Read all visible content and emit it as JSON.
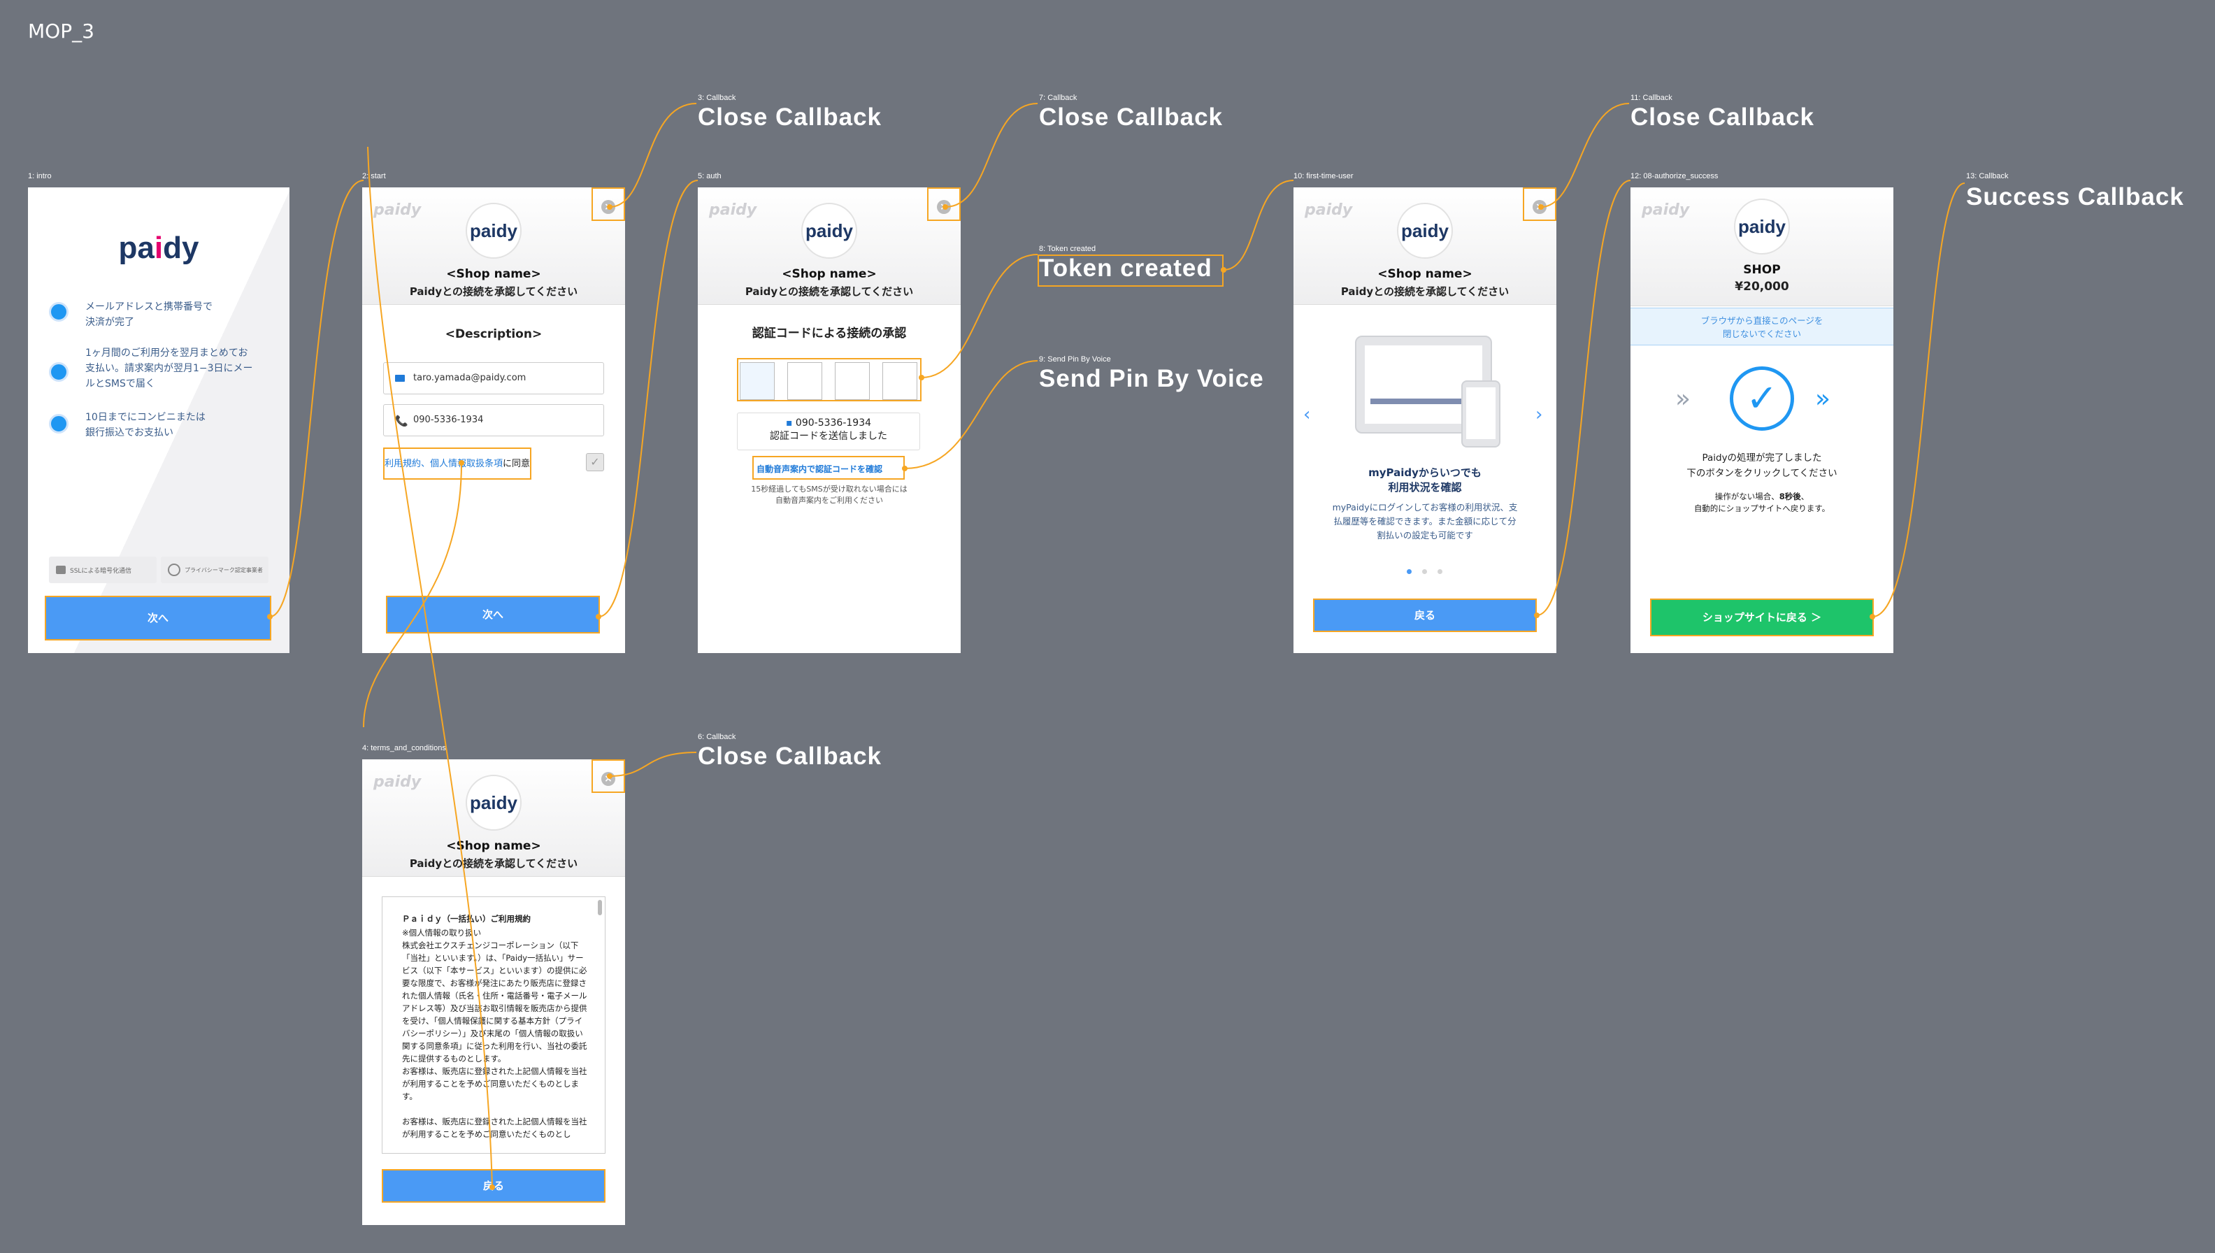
{
  "canvas_title": "MOP_3",
  "frames": {
    "f1": "1: intro",
    "f2": "2: start",
    "f3": "3: Callback",
    "f4": "4: terms_and_conditions",
    "f5": "5: auth",
    "f6": "6: Callback",
    "f7": "7: Callback",
    "f8": "8: Token created",
    "f9": "9: Send Pin By Voice",
    "f10": "10: first-time-user",
    "f11": "11: Callback",
    "f12": "12: 08-authorize_success",
    "f13": "13: Callback"
  },
  "callbacks": {
    "c3": "Close Callback",
    "c6": "Close Callback",
    "c7": "Close Callback",
    "c8": "Token created",
    "c9": "Send Pin By Voice",
    "c11": "Close Callback",
    "c13": "Success Callback"
  },
  "logo": {
    "pa": "pa",
    "i": "i",
    "dy": "dy",
    "full": "paidy"
  },
  "shop": {
    "name": "<Shop name>",
    "connect": "Paidyとの接続を承認してください",
    "close": "×"
  },
  "intro": {
    "bullets": [
      "メールアドレスと携帯番号で\n決済が完了",
      "1ヶ月間のご利用分を翌月まとめてお\n支払い。請求案内が翌月1−3日にメー\nルとSMSで届く",
      "10日までにコンビニまたは\n銀行振込でお支払い"
    ],
    "ssl": "SSLによる暗号化通信",
    "privacy": "プライバシーマーク認定事業者",
    "next": "次へ"
  },
  "start": {
    "description": "<Description>",
    "email": "taro.yamada@paidy.com",
    "phone": "090-5336-1934",
    "terms_link": "利用規約、個人情報取扱条項",
    "terms_suffix": "に同意",
    "next": "次へ"
  },
  "terms": {
    "title": "Ｐａｉｄｙ（一括払い）ご利用規約",
    "body": "※個人情報の取り扱い\n株式会社エクスチェンジコーポレーション（以下「当社」といいます。）は、「Paidy一括払い」サービス（以下「本サービス」といいます）の提供に必要な限度で、お客様が発注にあたり販売店に登録された個人情報（氏名・住所・電話番号・電子メールアドレス等）及び当該お取引情報を販売店から提供を受け、「個人情報保護に関する基本方針（プライバシーポリシー）」及び末尾の「個人情報の取扱い関する同意条項」に従った利用を行い、当社の委託先に提供するものとします。\nお客様は、販売店に登録された上記個人情報を当社が利用することを予めご同意いただくものとします。\n\nお客様は、販売店に登録された上記個人情報を当社が利用することを予めご同意いただくものとし",
    "back": "戻る"
  },
  "auth": {
    "title": "認証コードによる接続の承認",
    "phone": "090-5336-1934",
    "sent": "認証コードを送信しました",
    "voice_link": "自動音声案内で認証コードを確認",
    "notice": "15秒経過してもSMSが受け取れない場合には\n自動音声案内をご利用ください"
  },
  "first_time": {
    "heading": "myPaidyからいつでも\n利用状況を確認",
    "body": "myPaidyにログインしてお客様の利用状況、支\n払履歴等を確認できます。また金額に応じて分\n割払いの設定も可能です",
    "back": "戻る",
    "prev_arrow": "‹",
    "next_arrow": "›"
  },
  "success": {
    "shop": "SHOP",
    "amount": "¥20,000",
    "notice": "ブラウザから直接このページを\n閉じないでください",
    "done": "Paidyの処理が完了しました\n下のボタンをクリックしてください",
    "auto_before": "操作がない場合、",
    "auto_secs": "8秒後",
    "auto_after": "、\n自動的にショップサイトへ戻ります。",
    "button": "ショップサイトに戻る ＞"
  },
  "colors": {
    "accent": "#4a9af5",
    "highlight": "#f6a623",
    "success": "#1ec46a",
    "background": "#6f747d"
  }
}
